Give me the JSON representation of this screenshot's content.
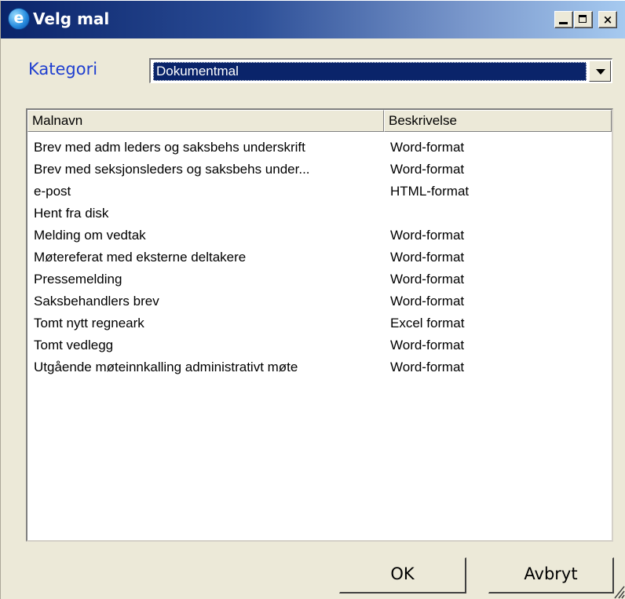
{
  "window": {
    "title": "Velg mal",
    "icon": "ie-e-icon",
    "controls": {
      "minimize": "minimize-icon",
      "maximize": "maximize-icon",
      "close": "×"
    }
  },
  "category": {
    "label": "Kategori",
    "selected": "Dokumentmal"
  },
  "list": {
    "columns": [
      "Malnavn",
      "Beskrivelse"
    ],
    "rows": [
      {
        "name": "Brev med adm leders og saksbehs underskrift",
        "desc": "Word-format"
      },
      {
        "name": "Brev med seksjonsleders og saksbehs under...",
        "desc": "Word-format"
      },
      {
        "name": "e-post",
        "desc": "HTML-format"
      },
      {
        "name": "Hent fra disk",
        "desc": ""
      },
      {
        "name": "Melding om vedtak",
        "desc": "Word-format"
      },
      {
        "name": "Møtereferat med eksterne deltakere",
        "desc": "Word-format"
      },
      {
        "name": "Pressemelding",
        "desc": "Word-format"
      },
      {
        "name": "Saksbehandlers brev",
        "desc": "Word-format"
      },
      {
        "name": "Tomt nytt regneark",
        "desc": "Excel format"
      },
      {
        "name": "Tomt vedlegg",
        "desc": "Word-format"
      },
      {
        "name": "Utgående møteinnkalling administrativt møte",
        "desc": "Word-format"
      }
    ]
  },
  "buttons": {
    "ok": "OK",
    "cancel": "Avbryt"
  },
  "colors": {
    "title_bar_start": "#0a246a",
    "title_bar_end": "#a6caf0",
    "selection": "#0a246a",
    "category_label": "#1f3fd0",
    "dialog_bg": "#ece9d8"
  }
}
